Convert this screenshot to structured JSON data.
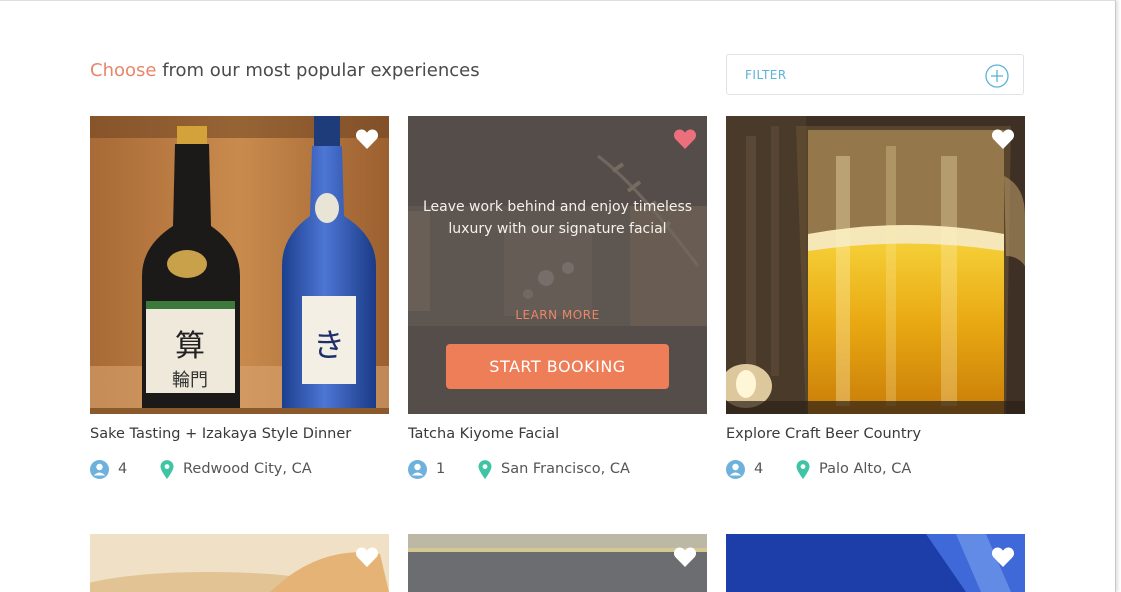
{
  "header": {
    "headline_accent": "Choose",
    "headline_rest": " from our most popular experiences",
    "filter_label": "FILTER"
  },
  "colors": {
    "accent": "#e8866a",
    "button": "#ee7e57",
    "info_blue": "#5bb3d6",
    "pin_teal": "#3fc4a4",
    "heart_active": "#ec6f7c"
  },
  "cards": [
    {
      "title": "Sake Tasting + Izakaya Style Dinner",
      "guests": "4",
      "location": "Redwood City, CA",
      "favorited": false
    },
    {
      "title": "Tatcha Kiyome Facial",
      "guests": "1",
      "location": "San Francisco, CA",
      "favorited": true,
      "overlay_text": "Leave work behind and enjoy timeless luxury with our signature facial",
      "learn_more_label": "LEARN MORE",
      "book_label": "START BOOKING"
    },
    {
      "title": "Explore Craft Beer Country",
      "guests": "4",
      "location": "Palo Alto, CA",
      "favorited": false
    }
  ],
  "second_row_cards": [
    {
      "favorited": false
    },
    {
      "favorited": false
    },
    {
      "favorited": false
    }
  ],
  "icons": {
    "filter": "plus-circle-icon",
    "favorite": "heart-icon",
    "guests": "person-icon",
    "location": "map-pin-icon"
  }
}
